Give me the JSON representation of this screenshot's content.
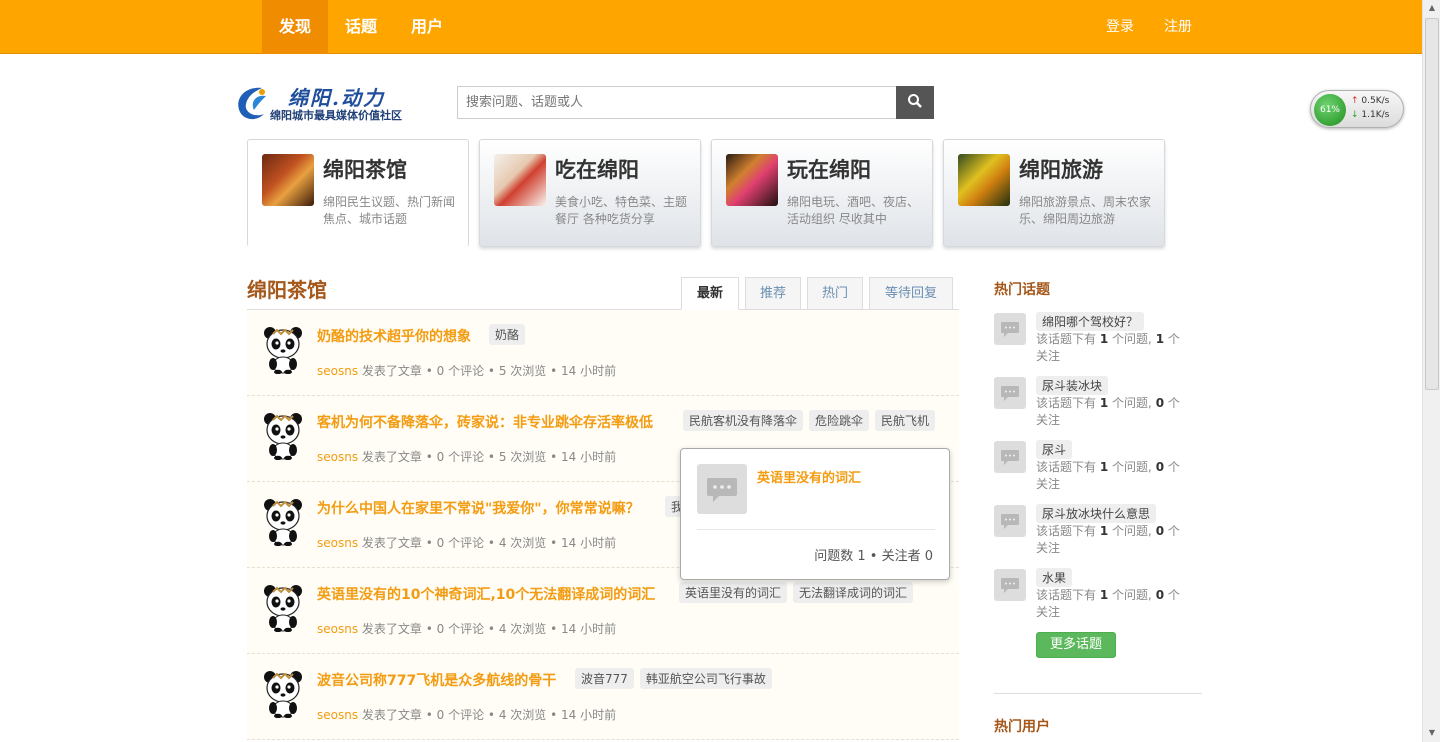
{
  "nav": {
    "items": [
      {
        "label": "发现"
      },
      {
        "label": "话题"
      },
      {
        "label": "用户"
      }
    ],
    "login": "登录",
    "register": "注册"
  },
  "logo": {
    "title": "绵阳.动力",
    "subtitle": "绵阳城市最具媒体价值社区"
  },
  "search": {
    "placeholder": "搜索问题、话题或人"
  },
  "net_widget": {
    "percent": "61%",
    "up": "0.5K/s",
    "down": "1.1K/s"
  },
  "categories": [
    {
      "title": "绵阳茶馆",
      "desc": "绵阳民生议题、热门新闻焦点、城市话题"
    },
    {
      "title": "吃在绵阳",
      "desc": "美食小吃、特色菜、主题餐厅 各种吃货分享"
    },
    {
      "title": "玩在绵阳",
      "desc": "绵阳电玩、酒吧、夜店、活动组织 尽收其中"
    },
    {
      "title": "绵阳旅游",
      "desc": "绵阳旅游景点、周末农家乐、绵阳周边旅游"
    }
  ],
  "section": {
    "title": "绵阳茶馆"
  },
  "tabs": [
    {
      "label": "最新"
    },
    {
      "label": "推荐"
    },
    {
      "label": "热门"
    },
    {
      "label": "等待回复"
    }
  ],
  "feed": [
    {
      "title": "奶酪的技术超乎你的想象",
      "tags": [
        "奶酪"
      ],
      "user": "seosns",
      "action": "发表了文章",
      "comments": "0 个评论",
      "views": "5 次浏览",
      "time": "14 小时前"
    },
    {
      "title": "客机为何不备降落伞，砖家说：非专业跳伞存活率极低",
      "tags": [
        "民航客机没有降落伞",
        "危险跳伞",
        "民航飞机"
      ],
      "user": "seosns",
      "action": "发表了文章",
      "comments": "0 个评论",
      "views": "5 次浏览",
      "time": "14 小时前"
    },
    {
      "title": "为什么中国人在家里不常说\"我爱你\"，你常常说嘛？",
      "tags": [
        "我"
      ],
      "user": "seosns",
      "action": "发表了文章",
      "comments": "0 个评论",
      "views": "4 次浏览",
      "time": "14 小时前"
    },
    {
      "title": "英语里没有的10个神奇词汇,10个无法翻译成词的词汇",
      "tags": [
        "英语里没有的词汇",
        "无法翻译成词的词汇"
      ],
      "user": "seosns",
      "action": "发表了文章",
      "comments": "0 个评论",
      "views": "4 次浏览",
      "time": "14 小时前"
    },
    {
      "title": "波音公司称777飞机是众多航线的骨干",
      "tags": [
        "波音777",
        "韩亚航空公司飞行事故"
      ],
      "user": "seosns",
      "action": "发表了文章",
      "comments": "0 个评论",
      "views": "4 次浏览",
      "time": "14 小时前"
    }
  ],
  "popup": {
    "title": "英语里没有的词汇",
    "questions_label": "问题数",
    "questions": "1",
    "followers_label": "关注者",
    "followers": "0"
  },
  "sidebar": {
    "hot_topics_title": "热门话题",
    "topics": [
      {
        "name": "绵阳哪个驾校好？",
        "questions": "1",
        "followers": "1"
      },
      {
        "name": "尿斗装冰块",
        "questions": "1",
        "followers": "0"
      },
      {
        "name": "尿斗",
        "questions": "1",
        "followers": "0"
      },
      {
        "name": "尿斗放冰块什么意思",
        "questions": "1",
        "followers": "0"
      },
      {
        "name": "水果",
        "questions": "1",
        "followers": "0"
      }
    ],
    "desc_prefix": "该话题下有",
    "desc_mid": "个问题,",
    "desc_suffix": "个关注",
    "more_topics": "更多话题",
    "hot_users_title": "热门用户"
  }
}
